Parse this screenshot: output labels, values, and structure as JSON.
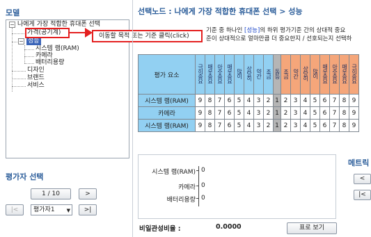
{
  "left": {
    "title": "모델",
    "tree": {
      "root": "나에게 가장 적합한 휴대폰 선택",
      "items": [
        "가격(공기계)",
        "성능",
        "시스템 램(RAM)",
        "카메라",
        "배터리용량",
        "디자인",
        "브랜드",
        "서비스"
      ]
    },
    "evaluator_title": "평가자 선택",
    "pager": "1 / 10",
    "next": ">",
    "prev_end": "|<",
    "next_end": ">|",
    "evaluator_value": "평가자1"
  },
  "callout": "이동할 목적 또는 기준 클릭(click)",
  "header": {
    "selected_node": "선택노드 : 나에게 가장 적합한 휴대폰 선택 > 성능"
  },
  "description": {
    "line1_pre": "기준 중 하나인 ",
    "line1_kw": "[성능]",
    "line1_post": "의 하위 평가기준 간의 상대적 중요",
    "line2": "준이 상대적으로 얼마만큼 더 중요한지 / 선호되는지 선택하"
  },
  "table": {
    "corner": "평가 요소",
    "left_headers": [
      "극히중요",
      "매우중요",
      "아주중요",
      "매우중요",
      "많이",
      "상당히",
      "약간",
      "조금"
    ],
    "mid_header": "동등",
    "right_headers": [
      "조금",
      "약간",
      "상당히",
      "많이",
      "매우중요",
      "아주중요",
      "매우중요",
      "극히중요"
    ],
    "rows": [
      {
        "label": "시스템 램(RAM)",
        "left": [
          "9",
          "8",
          "7",
          "6",
          "5",
          "4",
          "3",
          "2"
        ],
        "mid": "1",
        "right": [
          "2",
          "3",
          "4",
          "5",
          "6",
          "7",
          "8",
          "9"
        ]
      },
      {
        "label": "카메라",
        "left": [
          "9",
          "8",
          "7",
          "6",
          "5",
          "4",
          "3",
          "2"
        ],
        "mid": "1",
        "right": [
          "2",
          "3",
          "4",
          "5",
          "6",
          "7",
          "8",
          "9"
        ]
      },
      {
        "label": "시스템 램(RAM)",
        "left": [
          "9",
          "8",
          "7",
          "6",
          "5",
          "4",
          "3",
          "2"
        ],
        "mid": "1",
        "right": [
          "2",
          "3",
          "4",
          "5",
          "6",
          "7",
          "8",
          "9"
        ]
      }
    ]
  },
  "weights": {
    "items": [
      "시스템 램(RAM)",
      "카메라",
      "배터리용량"
    ],
    "zeros": [
      "0",
      "0",
      "0"
    ]
  },
  "consistency": {
    "label": "비일관성비율 :",
    "value": "0.0000",
    "button": "표로 보기"
  },
  "right_edge": {
    "title": "메트릭",
    "btn1": "<",
    "btn2": "|<"
  },
  "colors": {
    "accent": "#2b5d9a",
    "callout": "#e41f1f",
    "table_blue": "#92d0f2",
    "table_orange": "#f5a67a",
    "table_mid": "#b5b5b5",
    "selected_node": "#3a64b8"
  }
}
